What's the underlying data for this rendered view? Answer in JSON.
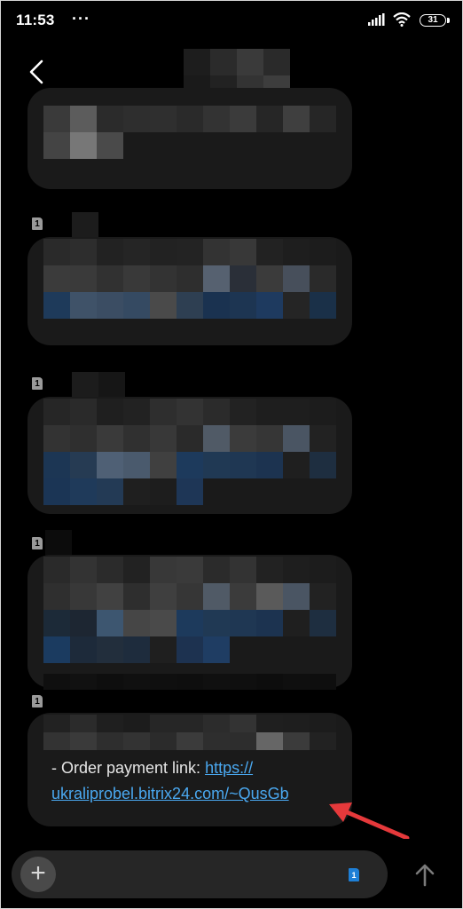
{
  "status_bar": {
    "time": "11:53",
    "overflow_dots": "···",
    "battery_level": "31"
  },
  "header": {
    "back_icon": "chevron-left-icon",
    "contact_name_redacted": true
  },
  "messages": [
    {
      "sim": "1",
      "redacted": true
    },
    {
      "sim": "1",
      "redacted": true
    },
    {
      "sim": "1",
      "redacted": true
    },
    {
      "sim": "1",
      "redacted": true
    },
    {
      "sim": "1",
      "redacted_top": true,
      "text_prefix": "- Order payment link: ",
      "link_line1": "https://",
      "link_line2": "ukraliprobel.bitrix24.com/~QusGb"
    }
  ],
  "annotation": {
    "color": "#e5393b",
    "icon": "red-arrow-icon"
  },
  "input_bar": {
    "add_icon": "plus-icon",
    "add_label": "+",
    "sim_label": "1",
    "send_icon": "arrow-up-icon"
  },
  "colors": {
    "background": "#000000",
    "bubble": "#1a1a1a",
    "link": "#4aa8f0",
    "sim_active": "#1e7fd6"
  }
}
